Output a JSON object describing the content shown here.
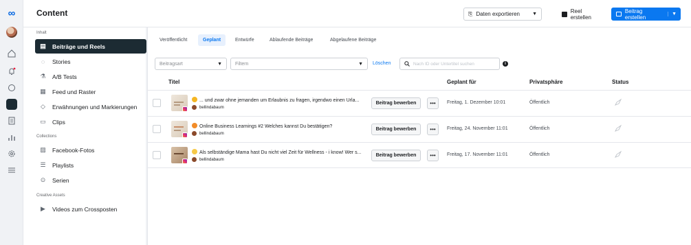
{
  "rail": {
    "icons": [
      "meta-logo-icon",
      "profile-avatar-icon",
      "home-icon",
      "notifications-icon",
      "messages-icon",
      "content-icon",
      "planner-icon",
      "insights-icon",
      "settings-icon",
      "menu-icon"
    ]
  },
  "header": {
    "title": "Content",
    "export_label": "Daten exportieren",
    "reel_label": "Reel erstellen",
    "create_post_label": "Beitrag erstellen"
  },
  "sidebar": {
    "section_content": "Inhalt",
    "section_collections": "Collections",
    "section_creative": "Creative Assets",
    "items": [
      {
        "label": "Beiträge und Reels",
        "icon": "posts-icon"
      },
      {
        "label": "Stories",
        "icon": "stories-icon"
      },
      {
        "label": "A/B Tests",
        "icon": "ab-test-icon"
      },
      {
        "label": "Feed und Raster",
        "icon": "grid-icon"
      },
      {
        "label": "Erwähnungen und Markierungen",
        "icon": "mentions-icon"
      },
      {
        "label": "Clips",
        "icon": "clips-icon"
      },
      {
        "label": "Facebook-Fotos",
        "icon": "photos-icon"
      },
      {
        "label": "Playlists",
        "icon": "playlists-icon"
      },
      {
        "label": "Serien",
        "icon": "series-icon"
      },
      {
        "label": "Videos zum Crossposten",
        "icon": "crosspost-icon"
      }
    ]
  },
  "tabs": [
    "Veröffentlicht",
    "Geplant",
    "Entwürfe",
    "Ablaufende Beiträge",
    "Abgelaufene Beiträge"
  ],
  "filters": {
    "post_type": "Beitragsart",
    "filter": "Filtern",
    "clear": "Löschen",
    "search_placeholder": "Nach ID oder Untertitel suchen"
  },
  "table": {
    "columns": {
      "title": "Titel",
      "scheduled": "Geplant für",
      "privacy": "Privatsphäre",
      "status": "Status"
    },
    "rows": [
      {
        "title": "... und zwar ohne jemanden um Erlaubnis zu fragen, irgendwo einen Urla...",
        "author": "bellindabaum",
        "boost": "Beitrag bewerben",
        "more": "•••",
        "date": "Freitag, 1. Dezember 10:01",
        "privacy": "Öffentlich"
      },
      {
        "title": "Online Business Learnings #2  Welches kannst Du bestätigen?",
        "author": "bellindabaum",
        "boost": "Beitrag bewerben",
        "more": "•••",
        "date": "Freitag, 24. November 11:01",
        "privacy": "Öffentlich"
      },
      {
        "title": "Als selbständige Mama hast Du nicht viel Zeit für Wellness - i know! Wer s...",
        "author": "bellindabaum",
        "boost": "Beitrag bewerben",
        "more": "•••",
        "date": "Freitag, 17. November 11:01",
        "privacy": "Öffentlich"
      }
    ]
  },
  "colors": {
    "accent": "#0a78f0",
    "active_nav": "#1c2b33",
    "brand": "#0064e0"
  }
}
